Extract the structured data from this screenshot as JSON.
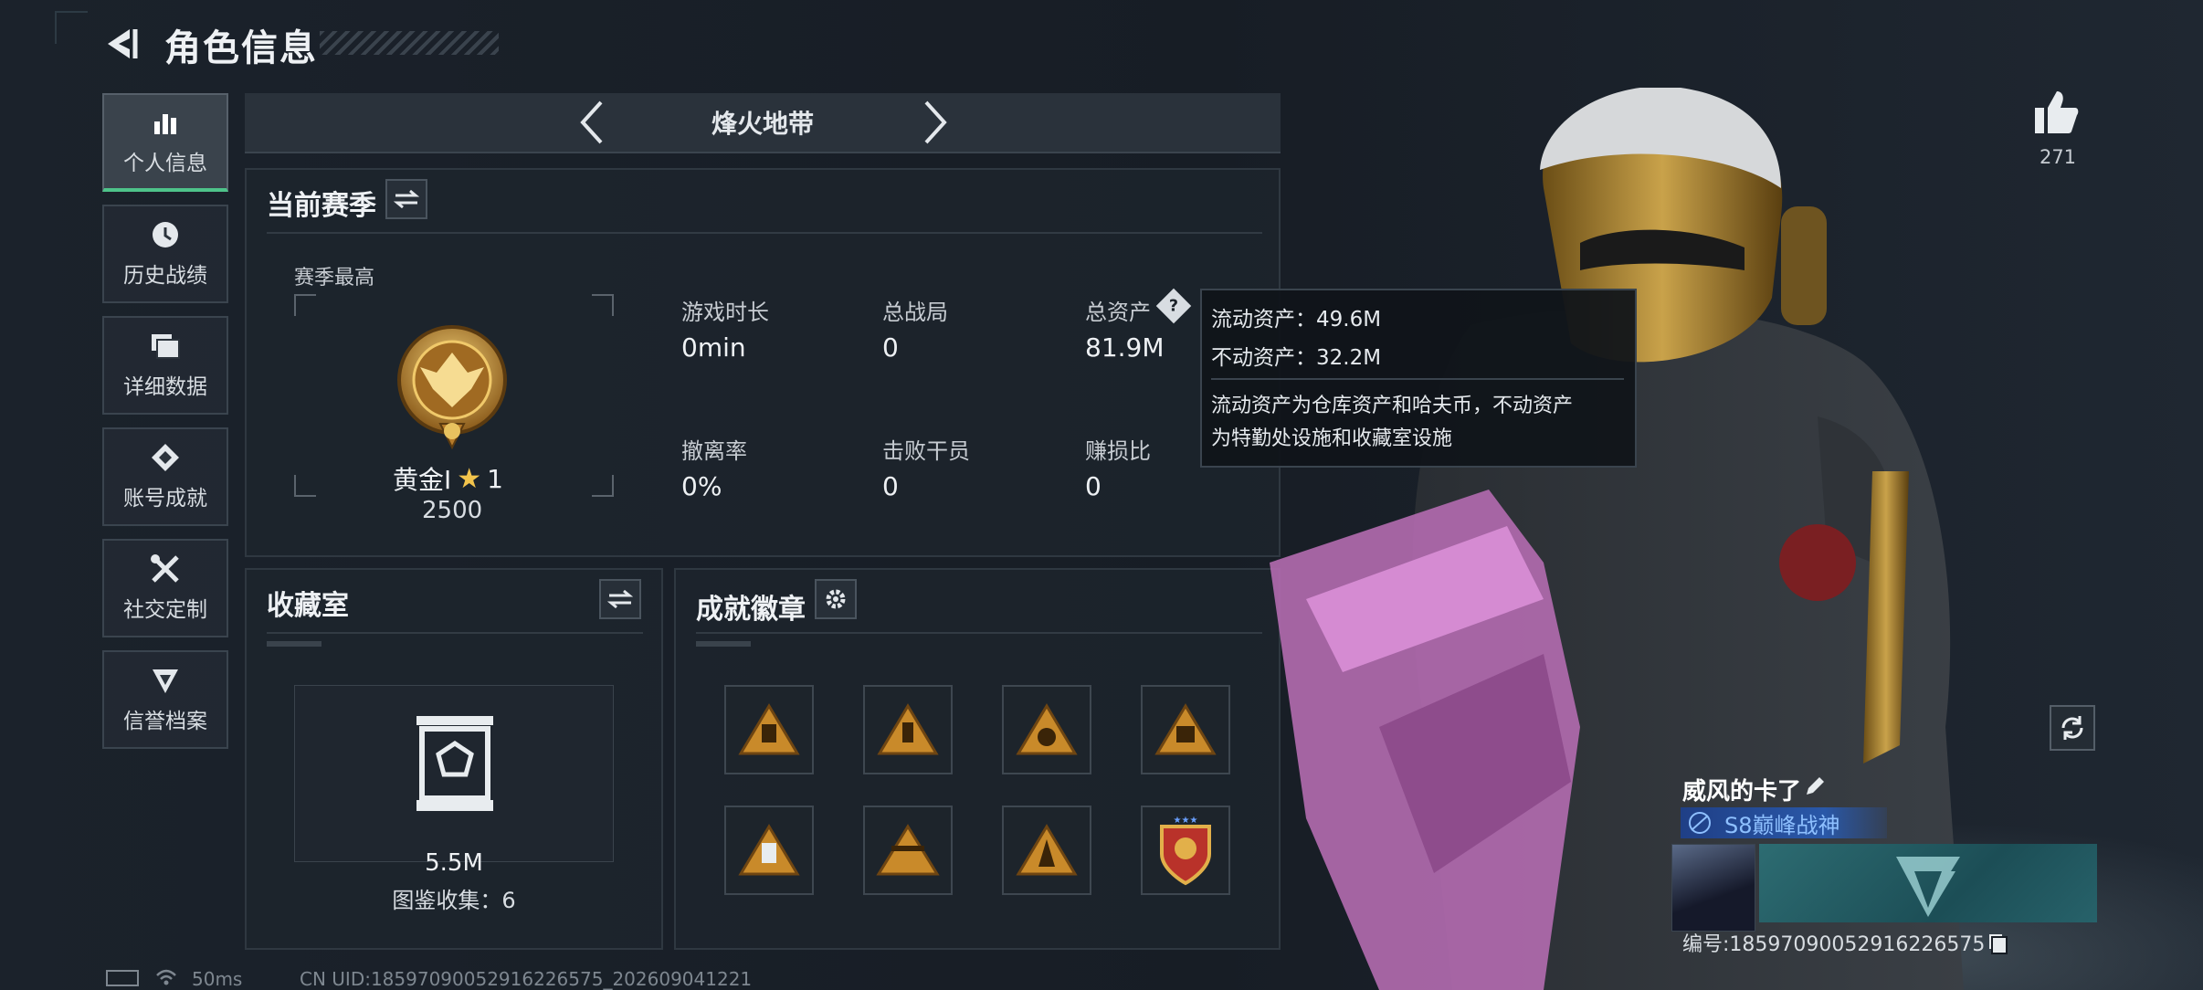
{
  "header": {
    "title": "角色信息"
  },
  "sidebar": {
    "items": [
      {
        "label": "个人信息",
        "icon": "bar-chart-icon",
        "active": true
      },
      {
        "label": "历史战绩",
        "icon": "clock-icon"
      },
      {
        "label": "详细数据",
        "icon": "folder-icon"
      },
      {
        "label": "账号成就",
        "icon": "achievement-icon"
      },
      {
        "label": "社交定制",
        "icon": "tools-icon"
      },
      {
        "label": "信誉档案",
        "icon": "shield-icon"
      }
    ]
  },
  "mode": {
    "label": "烽火地带"
  },
  "season": {
    "title": "当前赛季",
    "best_label": "赛季最高",
    "rank_name": "黄金Ⅰ",
    "rank_stars": "1",
    "rank_points": "2500",
    "stats": [
      {
        "label": "游戏时长",
        "value": "0min"
      },
      {
        "label": "总战局",
        "value": "0"
      },
      {
        "label": "总资产",
        "value": "81.9M"
      },
      {
        "label": "撤离率",
        "value": "0%"
      },
      {
        "label": "击败干员",
        "value": "0"
      },
      {
        "label": "赚损比",
        "value": "0"
      }
    ]
  },
  "tooltip": {
    "liquid": "流动资产：49.6M",
    "fixed": "不动资产：32.2M",
    "desc1": "流动资产为仓库资产和哈夫币，不动资产",
    "desc2": "为特勤处设施和收藏室设施"
  },
  "collection": {
    "title": "收藏室",
    "value": "5.5M",
    "count_label": "图鉴收集：6"
  },
  "badges": {
    "title": "成就徽章"
  },
  "likes": {
    "count": "271"
  },
  "player": {
    "name": "威风的卡了",
    "season_tag": "S8巅峰战神",
    "uid": "编号:1859709005291622657​5"
  },
  "footer": {
    "ping": "50ms",
    "uid": "CN UID:18597090052916226575_202609041221"
  },
  "colors": {
    "accent": "#4ec38a",
    "tag": "#2a58a8"
  }
}
